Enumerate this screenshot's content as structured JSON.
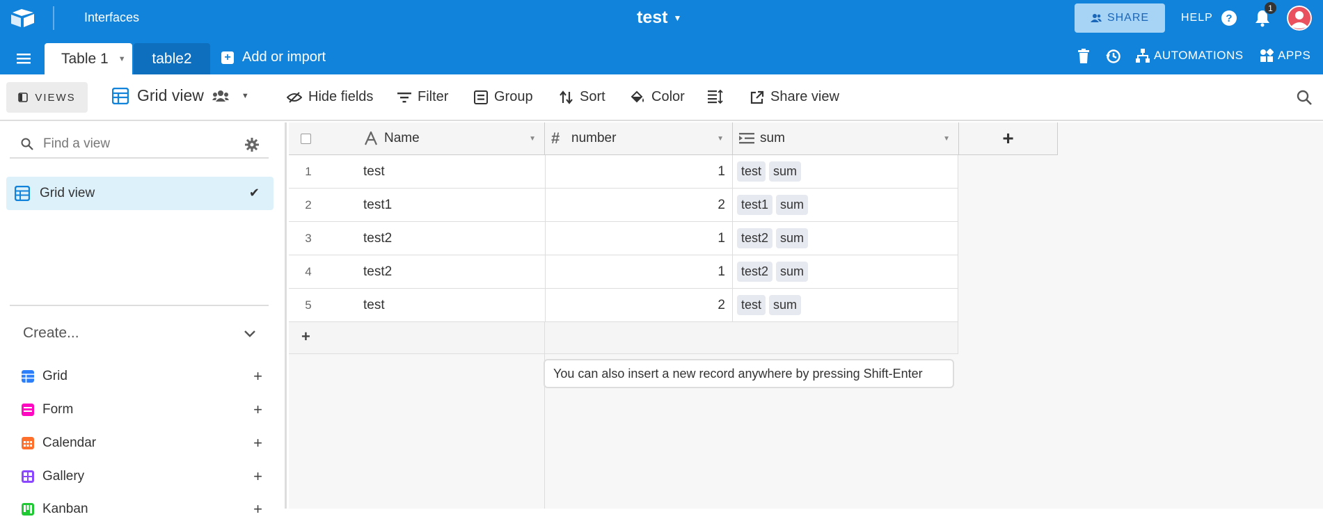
{
  "topbar": {
    "interfaces_label": "Interfaces",
    "base_title": "test",
    "share_label": "SHARE",
    "help_label": "HELP",
    "notification_count": "1",
    "accent_color": "#1283da"
  },
  "tabs": {
    "active_table": "Table 1",
    "second_table": "table2",
    "add_import_label": "Add or import",
    "automations_label": "AUTOMATIONS",
    "apps_label": "APPS"
  },
  "viewbar": {
    "views_label": "VIEWS",
    "current_view": "Grid view",
    "tools": [
      "Hide fields",
      "Filter",
      "Group",
      "Sort",
      "Color",
      "Share view"
    ]
  },
  "sidebar": {
    "find_placeholder": "Find a view",
    "active_view": "Grid view",
    "create_label": "Create...",
    "create_types": [
      {
        "label": "Grid",
        "color": "#2d7ff9"
      },
      {
        "label": "Form",
        "color": "#ff08c2"
      },
      {
        "label": "Calendar",
        "color": "#ff6f2c"
      },
      {
        "label": "Gallery",
        "color": "#8b46ff"
      },
      {
        "label": "Kanban",
        "color": "#20c933"
      }
    ]
  },
  "grid": {
    "columns": [
      "Name",
      "number",
      "sum"
    ],
    "rows": [
      {
        "num": "1",
        "name": "test",
        "number": "1",
        "sum": [
          "test",
          "sum"
        ]
      },
      {
        "num": "2",
        "name": "test1",
        "number": "2",
        "sum": [
          "test1",
          "sum"
        ]
      },
      {
        "num": "3",
        "name": "test2",
        "number": "1",
        "sum": [
          "test2",
          "sum"
        ]
      },
      {
        "num": "4",
        "name": "test2",
        "number": "1",
        "sum": [
          "test2",
          "sum"
        ]
      },
      {
        "num": "5",
        "name": "test",
        "number": "2",
        "sum": [
          "test",
          "sum"
        ]
      }
    ],
    "add_row_symbol": "+",
    "add_field_symbol": "+",
    "tooltip": "You can also insert a new record anywhere by pressing Shift-Enter"
  }
}
